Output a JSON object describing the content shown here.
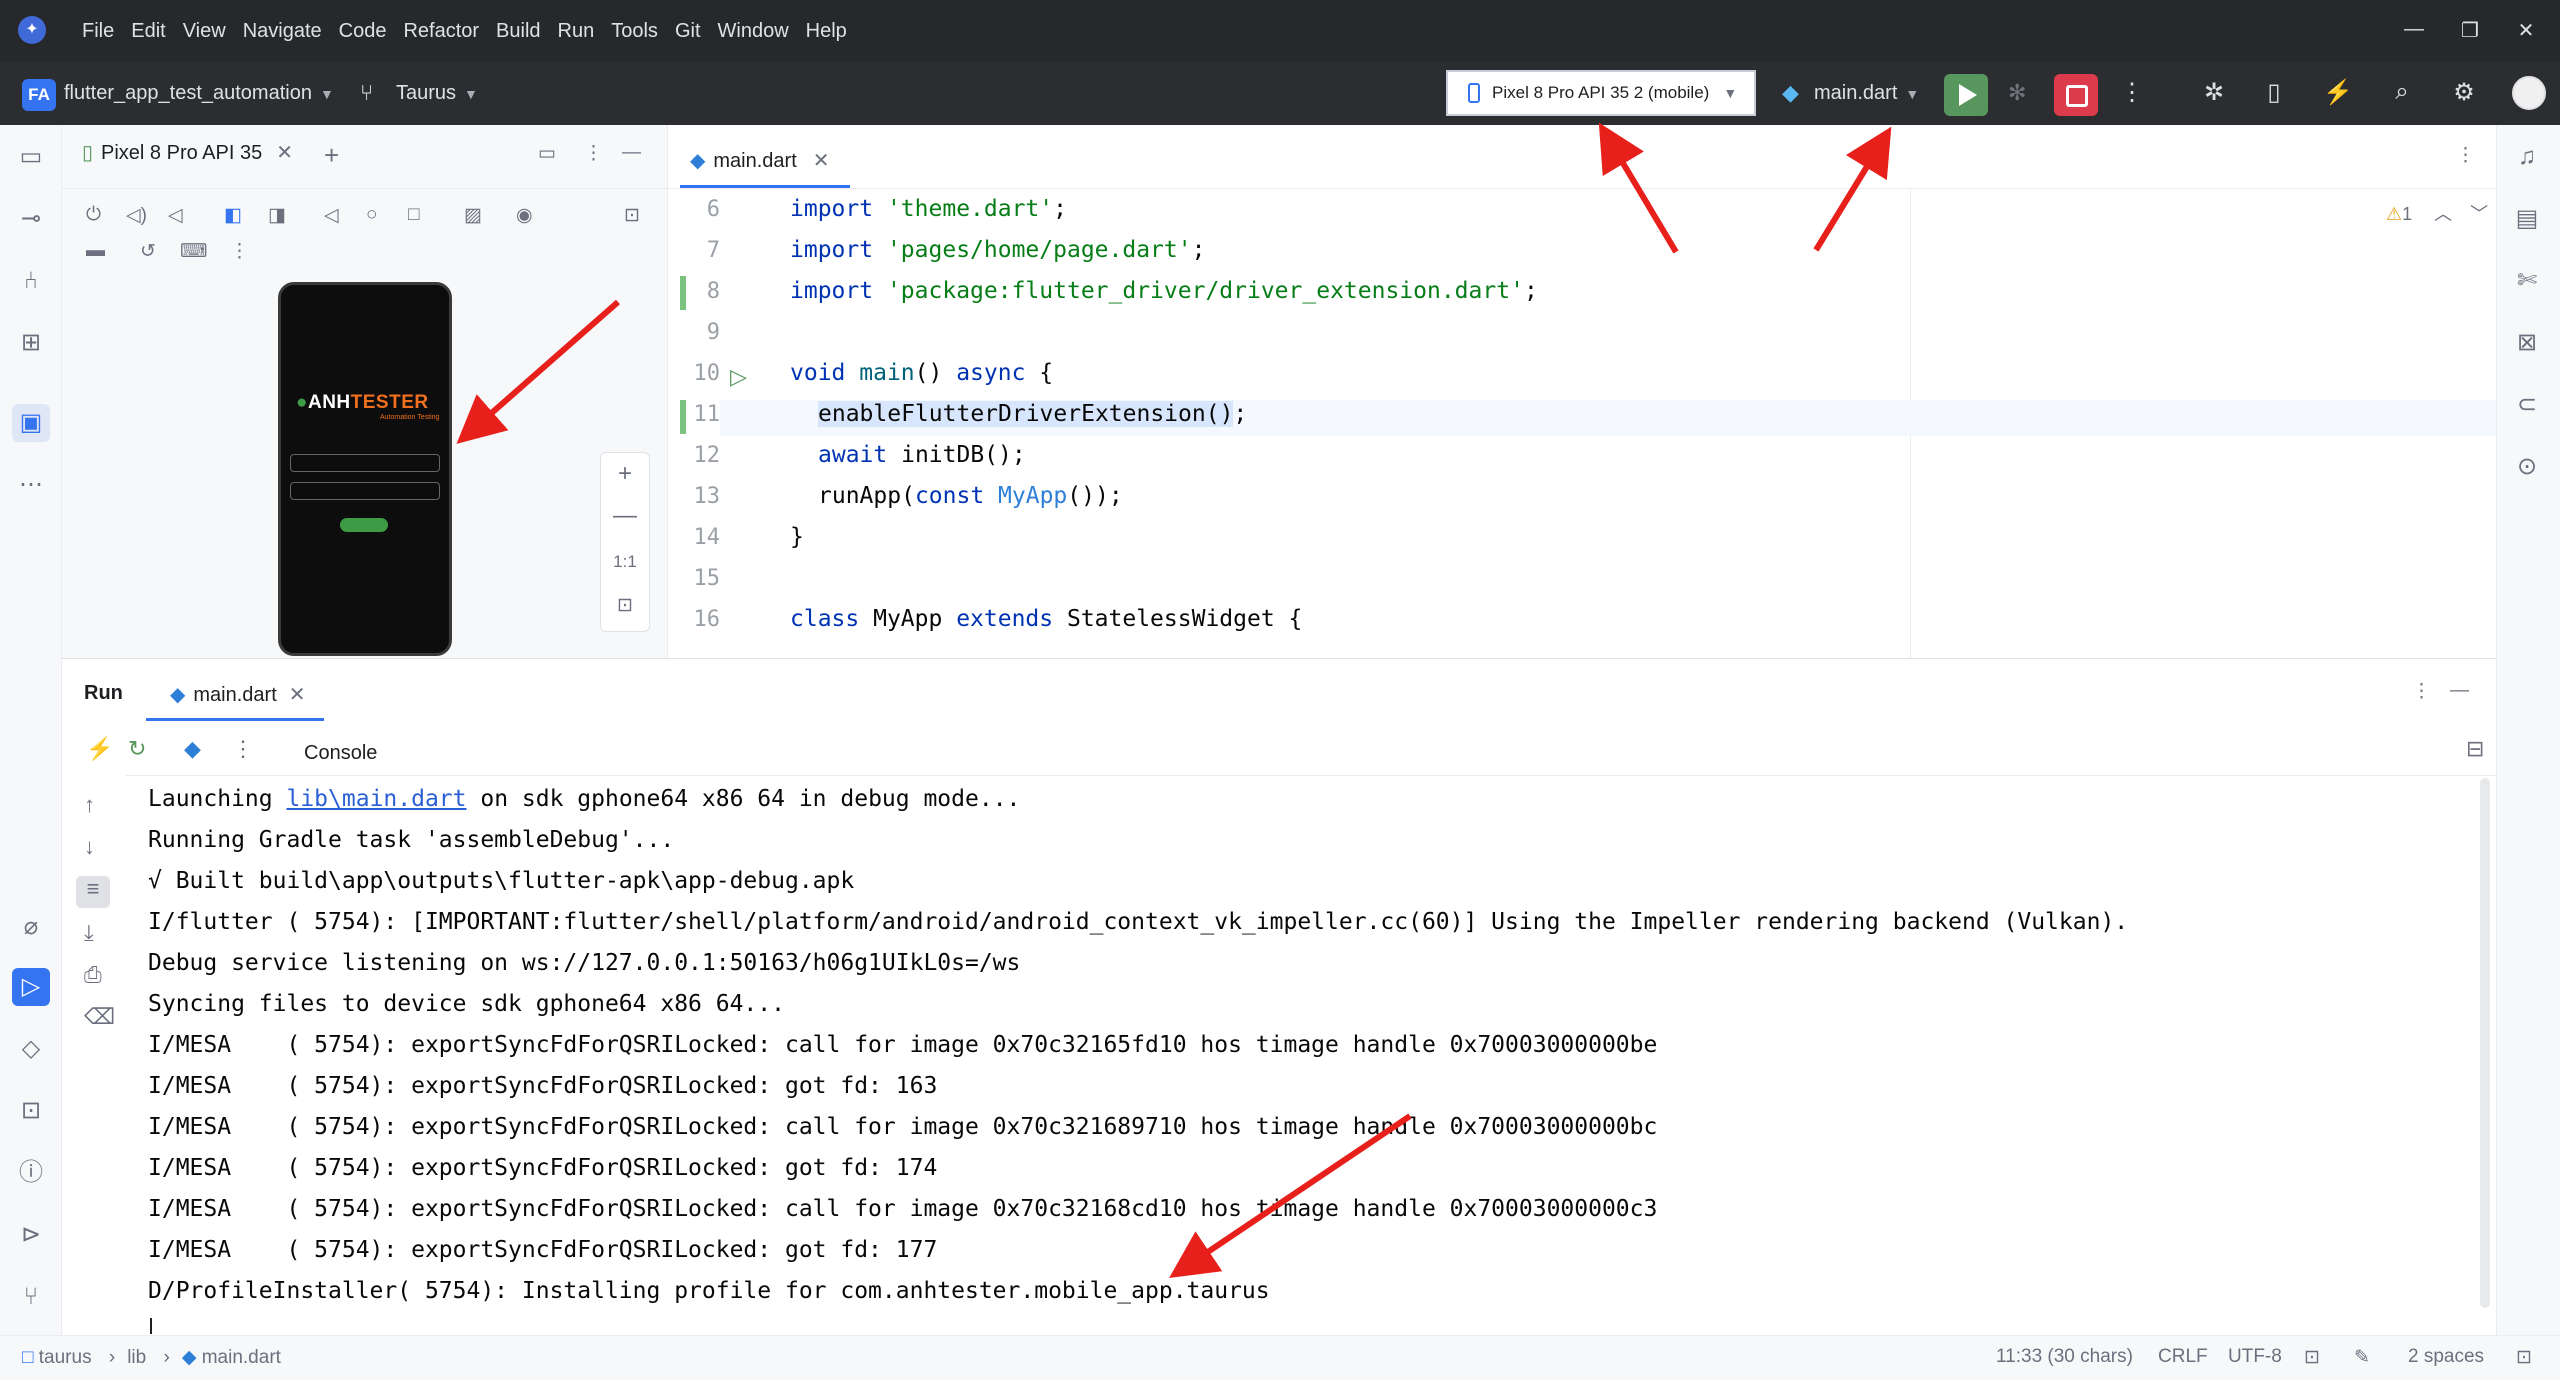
{
  "menu": [
    "File",
    "Edit",
    "View",
    "Navigate",
    "Code",
    "Refactor",
    "Build",
    "Run",
    "Tools",
    "Git",
    "Window",
    "Help"
  ],
  "toolbar": {
    "project_badge": "FA",
    "project_name": "flutter_app_test_automation",
    "branch": "Taurus",
    "device": "Pixel 8 Pro API 35 2 (mobile)",
    "run_config": "main.dart"
  },
  "devices_panel": {
    "tab": "Pixel 8 Pro API 35",
    "zoom_ratio": "1:1",
    "phone": {
      "brand_a": "ANH",
      "brand_b": "TESTER",
      "subtitle": "Automation Testing"
    }
  },
  "editor": {
    "tab": "main.dart",
    "inspection_count": "1",
    "lines": [
      {
        "n": "6"
      },
      {
        "n": "7"
      },
      {
        "n": "8"
      },
      {
        "n": "9"
      },
      {
        "n": "10"
      },
      {
        "n": "11"
      },
      {
        "n": "12"
      },
      {
        "n": "13"
      },
      {
        "n": "14"
      },
      {
        "n": "15"
      },
      {
        "n": "16"
      }
    ],
    "code": {
      "l6_kw": "import",
      "l6_str": "'theme.dart'",
      "l6_end": ";",
      "l7_kw": "import",
      "l7_str": "'pages/home/page.dart'",
      "l7_end": ";",
      "l8_kw": "import",
      "l8_str": "'package:flutter_driver/driver_extension.dart'",
      "l8_end": ";",
      "l10_kw": "void",
      "l10_fn": "main",
      "l10_mid": "() ",
      "l10_kw2": "async",
      "l10_end": " {",
      "l11_fn": "enableFlutterDriverExtension()",
      "l11_end": ";",
      "l12_kw": "await",
      "l12_rest": " initDB();",
      "l13_a": "runApp(",
      "l13_kw": "const",
      "l13_sp": " ",
      "l13_cls": "MyApp",
      "l13_end": "());",
      "l14": "}",
      "l16_kw": "class",
      "l16_mid": " MyApp ",
      "l16_kw2": "extends",
      "l16_end": " StatelessWidget {"
    }
  },
  "run_panel": {
    "title": "Run",
    "tab": "main.dart",
    "console_label": "Console",
    "console": {
      "l1_a": "Launching ",
      "l1_link": "lib\\main.dart",
      "l1_b": " on sdk gphone64 x86 64 in debug mode...",
      "l2": "Running Gradle task 'assembleDebug'...",
      "l3": "√ Built build\\app\\outputs\\flutter-apk\\app-debug.apk",
      "l4": "I/flutter ( 5754): [IMPORTANT:flutter/shell/platform/android/android_context_vk_impeller.cc(60)] Using the Impeller rendering backend (Vulkan).",
      "l5": "Debug service listening on ws://127.0.0.1:50163/h06g1UIkL0s=/ws",
      "l6": "Syncing files to device sdk gphone64 x86 64...",
      "l7": "I/MESA    ( 5754): exportSyncFdForQSRILocked: call for image 0x70c32165fd10 hos timage handle 0x70003000000be",
      "l8": "I/MESA    ( 5754): exportSyncFdForQSRILocked: got fd: 163",
      "l9": "I/MESA    ( 5754): exportSyncFdForQSRILocked: call for image 0x70c321689710 hos timage handle 0x70003000000bc",
      "l10": "I/MESA    ( 5754): exportSyncFdForQSRILocked: got fd: 174",
      "l11": "I/MESA    ( 5754): exportSyncFdForQSRILocked: call for image 0x70c32168cd10 hos timage handle 0x70003000000c3",
      "l12": "I/MESA    ( 5754): exportSyncFdForQSRILocked: got fd: 177",
      "l13": "D/ProfileInstaller( 5754): Installing profile for com.anhtester.mobile_app.taurus"
    }
  },
  "statusbar": {
    "crumb1": "taurus",
    "crumb2": "lib",
    "crumb3": "main.dart",
    "position": "11:33 (30 chars)",
    "line_sep": "CRLF",
    "encoding": "UTF-8",
    "indent": "2 spaces"
  },
  "colors": {
    "accent": "#3574f0",
    "run_green": "#57965c",
    "stop_red": "#db3b4b",
    "annotation_red": "#e8201c"
  }
}
